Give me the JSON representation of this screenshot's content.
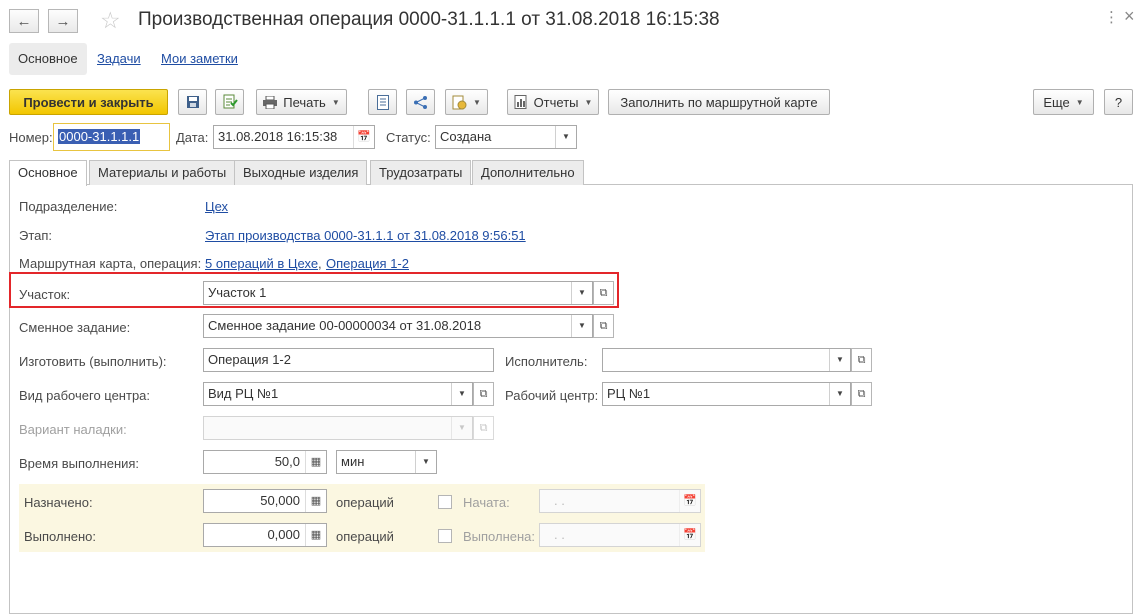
{
  "window": {
    "title": "Производственная операция 0000-31.1.1.1 от 31.08.2018 16:15:38",
    "back_icon": "arrow-left-icon",
    "forward_icon": "arrow-right-icon",
    "favorite_icon": "star-icon",
    "menu_icon": "more-vertical-icon",
    "close_icon": "close-icon",
    "menu_glyph": "⋮",
    "close_glyph": "×"
  },
  "page_tabs": [
    "Основное",
    "Задачи",
    "Мои заметки"
  ],
  "toolbar": {
    "post_close": "Провести и закрыть",
    "print": "Печать",
    "reports": "Отчеты",
    "fill_route": "Заполнить по маршрутной карте",
    "more": "Еще",
    "help": "?"
  },
  "header": {
    "number_label": "Номер:",
    "number_value": "0000-31.1.1.1",
    "date_label": "Дата:",
    "date_value": "31.08.2018 16:15:38",
    "status_label": "Статус:",
    "status_value": "Создана"
  },
  "tabs": [
    "Основное",
    "Материалы и работы",
    "Выходные изделия",
    "Трудозатраты",
    "Дополнительно"
  ],
  "form": {
    "department_label": "Подразделение:",
    "department_value": "Цех",
    "stage_label": "Этап:",
    "stage_value": "Этап производства 0000-31.1.1 от 31.08.2018 9:56:51",
    "route_label": "Маршрутная карта, операция:",
    "route_value_1": "5 операций в Цехе",
    "route_sep": ",",
    "route_value_2": "Операция 1-2",
    "section_label": "Участок:",
    "section_value": "Участок 1",
    "shift_label": "Сменное задание:",
    "shift_value": "Сменное задание 00-00000034 от 31.08.2018",
    "make_label": "Изготовить (выполнить):",
    "make_value": "Операция 1-2",
    "executor_label": "Исполнитель:",
    "executor_value": "",
    "wc_type_label": "Вид рабочего центра:",
    "wc_type_value": "Вид РЦ №1",
    "wc_label": "Рабочий центр:",
    "wc_value": "РЦ №1",
    "setup_label": "Вариант наладки:",
    "setup_value": "",
    "time_label": "Время выполнения:",
    "time_value": "50,0",
    "time_unit": "мин",
    "assigned_label": "Назначено:",
    "assigned_value": "50,000",
    "assigned_unit": "операций",
    "started_label": "Начата:",
    "started_value": ". .",
    "done_label": "Выполнено:",
    "done_value": "0,000",
    "done_unit": "операций",
    "finished_label": "Выполнена:",
    "finished_value": ". ."
  },
  "colors": {
    "primary_button": "#f2c600",
    "link": "#1f4da3",
    "highlight_border": "#e3262a",
    "yellow_panel": "#fbf7e1"
  }
}
